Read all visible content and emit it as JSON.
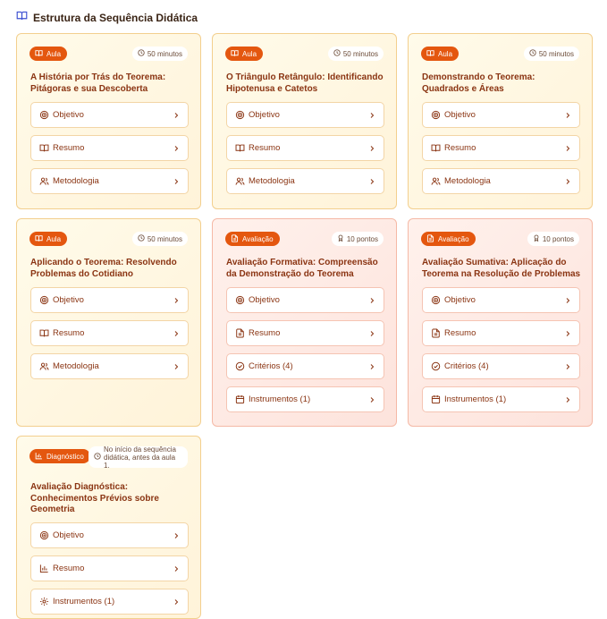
{
  "header": {
    "title": "Estrutura da Sequência Didática"
  },
  "cards": [
    {
      "badge": "Aula",
      "meta": "50 minutos",
      "title": "A História por Trás do Teorema: Pitágoras e sua Descoberta",
      "items": [
        "Objetivo",
        "Resumo",
        "Metodologia"
      ]
    },
    {
      "badge": "Aula",
      "meta": "50 minutos",
      "title": "O Triângulo Retângulo: Identificando Hipotenusa e Catetos",
      "items": [
        "Objetivo",
        "Resumo",
        "Metodologia"
      ]
    },
    {
      "badge": "Aula",
      "meta": "50 minutos",
      "title": "Demonstrando o Teorema: Quadrados e Áreas",
      "items": [
        "Objetivo",
        "Resumo",
        "Metodologia"
      ]
    },
    {
      "badge": "Aula",
      "meta": "50 minutos",
      "title": "Aplicando o Teorema: Resolvendo Problemas do Cotidiano",
      "items": [
        "Objetivo",
        "Resumo",
        "Metodologia"
      ]
    },
    {
      "badge": "Avaliação",
      "meta": "10 pontos",
      "title": "Avaliação Formativa: Compreensão da Demonstração do Teorema",
      "items": [
        "Objetivo",
        "Resumo",
        "Critérios (4)",
        "Instrumentos (1)"
      ]
    },
    {
      "badge": "Avaliação",
      "meta": "10 pontos",
      "title": "Avaliação Sumativa: Aplicação do Teorema na Resolução de Problemas",
      "items": [
        "Objetivo",
        "Resumo",
        "Critérios (4)",
        "Instrumentos (1)"
      ]
    },
    {
      "badge": "Diagnóstico",
      "meta": "No início da sequência didática, antes da aula 1.",
      "title": "Avaliação Diagnóstica: Conhecimentos Prévios sobre Geometria",
      "items": [
        "Objetivo",
        "Resumo",
        "Instrumentos (1)"
      ]
    }
  ],
  "colors": {
    "accent": "#e4570f",
    "text": "#8a3412",
    "lesson_bg": "#fff7e3",
    "eval_bg": "#fdeae3"
  }
}
